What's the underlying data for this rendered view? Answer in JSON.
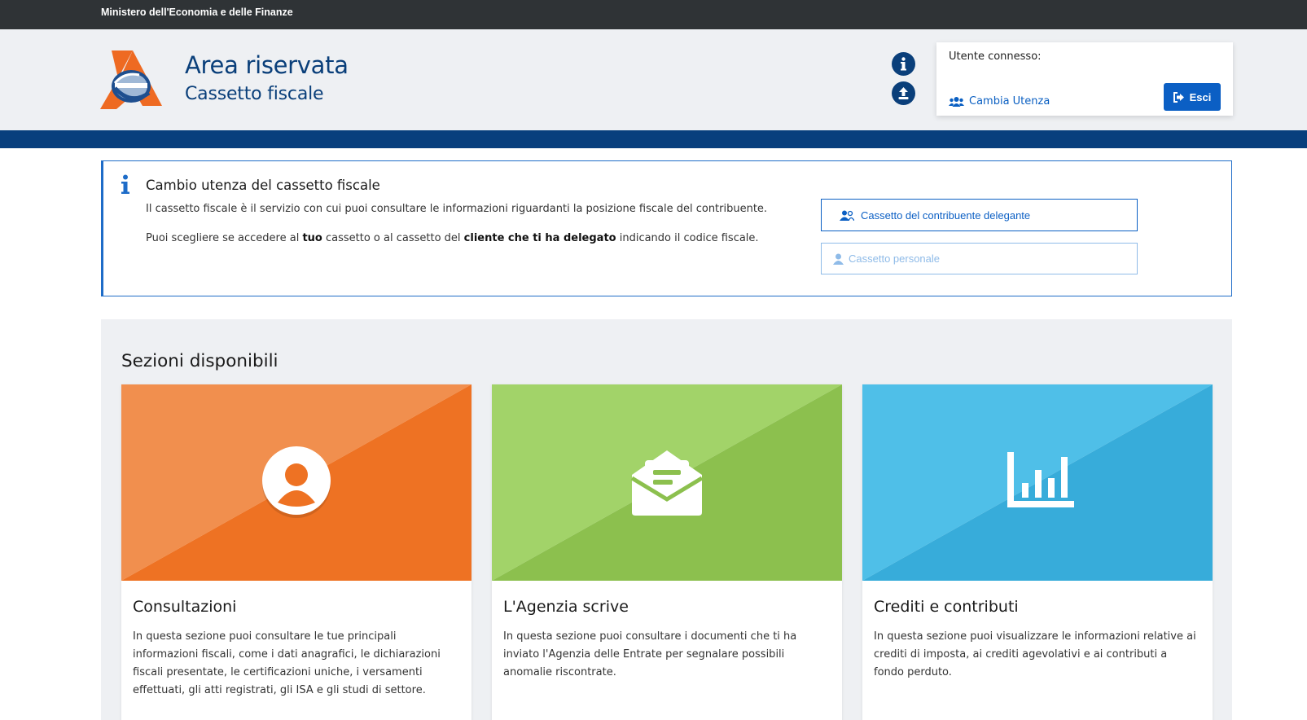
{
  "topbar": {
    "ministry": "Ministero dell'Economia e delle Finanze"
  },
  "header": {
    "title": "Area riservata",
    "subtitle": "Cassetto fiscale",
    "info_icon": "info-icon",
    "upload_icon": "upload-icon"
  },
  "user": {
    "label": "Utente connesso:",
    "change_user": "Cambia Utenza",
    "logout": "Esci"
  },
  "info_panel": {
    "title": "Cambio utenza del cassetto fiscale",
    "paragraph1": "Il cassetto fiscale è il servizio con cui puoi consultare le informazioni riguardanti la posizione fiscale del contribuente.",
    "paragraph2_a": "Puoi scegliere se accedere al ",
    "paragraph2_b": "tuo",
    "paragraph2_c": " cassetto o al cassetto del ",
    "paragraph2_d": "cliente che ti ha delegato",
    "paragraph2_e": " indicando il codice fiscale.",
    "btn_delegante": "Cassetto del contribuente delegante",
    "btn_personale": "Cassetto personale"
  },
  "sections": {
    "title": "Sezioni disponibili",
    "cards": [
      {
        "title": "Consultazioni",
        "description": "In questa sezione puoi consultare le tue principali informazioni fiscali, come i dati anagrafici, le dichiarazioni fiscali presentate, le certificazioni uniche, i versamenti effettuati, gli atti registrati, gli ISA e gli studi di settore.",
        "icon": "user-icon",
        "color_light": "#f18f4e",
        "color_dark": "#ee7223"
      },
      {
        "title": "L'Agenzia scrive",
        "description": "In questa sezione puoi consultare i documenti che ti ha inviato l'Agenzia delle Entrate per segnalare possibili anomalie riscontrate.",
        "icon": "envelope-icon",
        "color_light": "#a2d369",
        "color_dark": "#8cc04e"
      },
      {
        "title": "Crediti e contributi",
        "description": "In questa sezione puoi visualizzare le informazioni relative ai crediti di imposta, ai crediti agevolativi e ai contributi a fondo perduto.",
        "icon": "bar-chart-icon",
        "color_light": "#4fbfe8",
        "color_dark": "#37acda"
      }
    ]
  }
}
